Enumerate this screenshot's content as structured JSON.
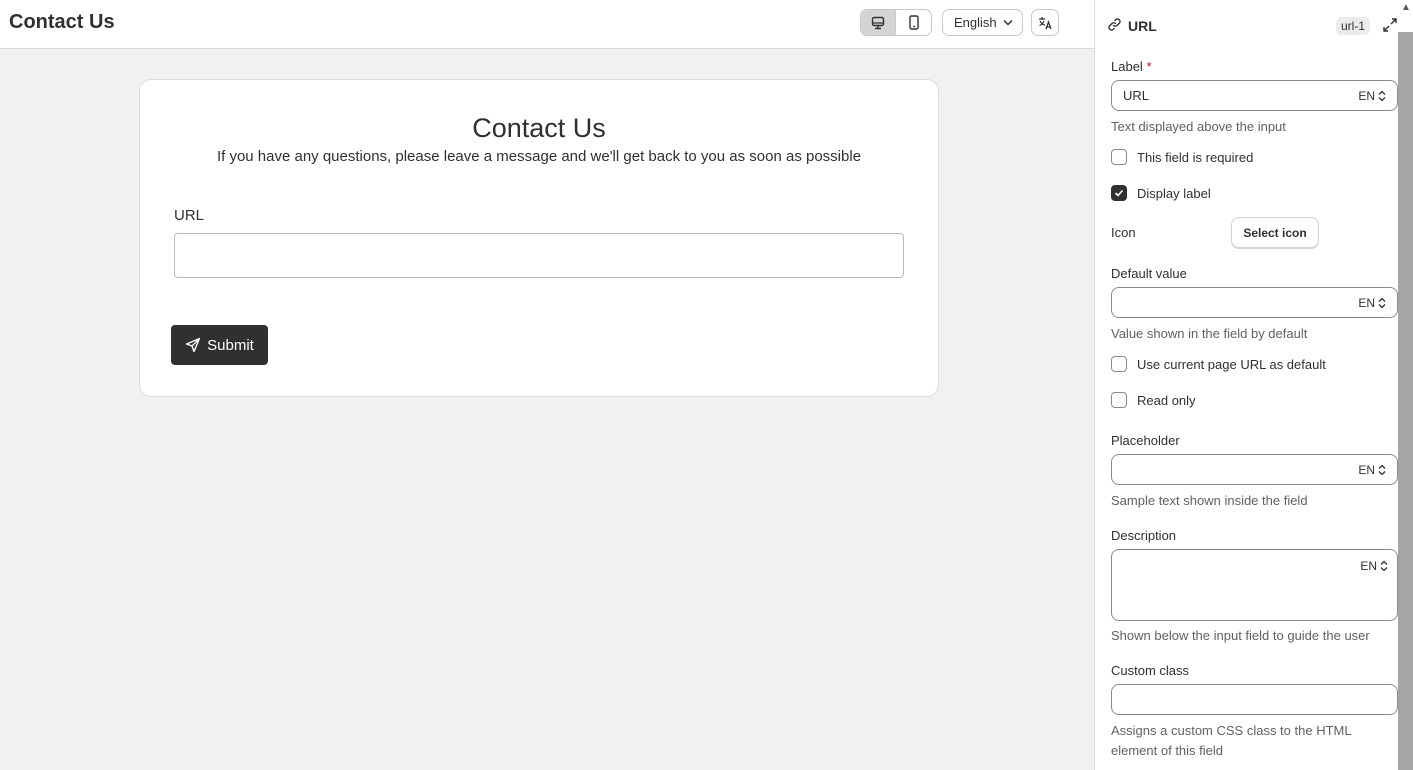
{
  "header": {
    "title": "Contact Us",
    "language": "English"
  },
  "form": {
    "heading": "Contact Us",
    "subheading": "If you have any questions, please leave a message and we'll get back to you as soon as possible",
    "field_label": "URL",
    "field_value": "",
    "submit_label": "Submit"
  },
  "panel": {
    "title": "URL",
    "id_badge": "url-1",
    "label_field": {
      "label": "Label",
      "required_mark": "*",
      "value": "URL",
      "locale": "EN",
      "help": "Text displayed above the input"
    },
    "required_checkbox": {
      "label": "This field is required",
      "checked": false
    },
    "display_label_checkbox": {
      "label": "Display label",
      "checked": true
    },
    "icon": {
      "label": "Icon",
      "button": "Select icon"
    },
    "default_value": {
      "label": "Default value",
      "value": "",
      "locale": "EN",
      "help": "Value shown in the field by default"
    },
    "current_url_checkbox": {
      "label": "Use current page URL as default",
      "checked": false
    },
    "read_only_checkbox": {
      "label": "Read only",
      "checked": false
    },
    "placeholder": {
      "label": "Placeholder",
      "value": "",
      "locale": "EN",
      "help": "Sample text shown inside the field"
    },
    "description": {
      "label": "Description",
      "value": "",
      "locale": "EN",
      "help": "Shown below the input field to guide the user"
    },
    "custom_class": {
      "label": "Custom class",
      "value": "",
      "help": "Assigns a custom CSS class to the HTML element of this field"
    }
  },
  "colors": {
    "primary_button": "#303030",
    "canvas_bg": "#f1f1f1",
    "required": "#c70a24"
  },
  "icons": [
    "desktop-icon",
    "mobile-icon",
    "chevron-down-icon",
    "translate-icon",
    "send-icon",
    "link-icon",
    "expand-icon",
    "updown-icon",
    "check-icon"
  ]
}
